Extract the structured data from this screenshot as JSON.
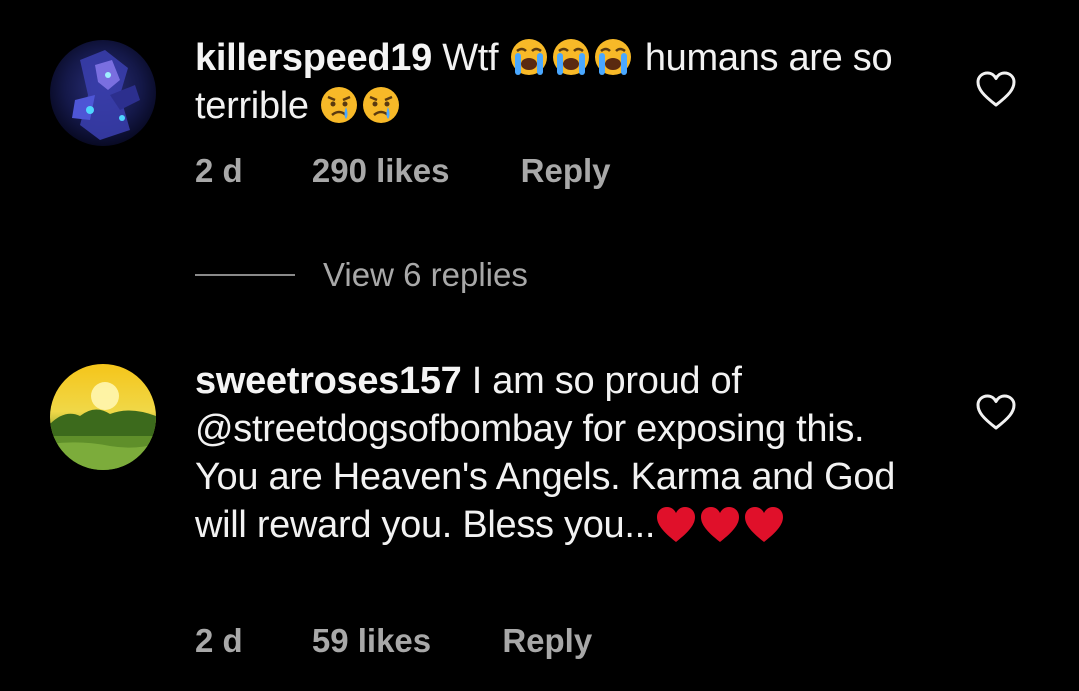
{
  "comments": [
    {
      "username": "killerspeed19",
      "text_before": "Wtf",
      "emoji_1": "loudly-crying-face",
      "text_after": "humans are so terrible",
      "emoji_2": "crying-face",
      "time": "2 d",
      "likes": "290 likes",
      "reply": "Reply",
      "view_replies": "View 6 replies"
    },
    {
      "username": "sweetroses157",
      "text": "I am so proud of @streetdogsofbombay  for exposing this.  You are Heaven's Angels.  Karma and God will reward you.  Bless you...",
      "emoji": "red-heart",
      "time": "2 d",
      "likes": "59 likes",
      "reply": "Reply"
    }
  ],
  "colors": {
    "background": "#000000",
    "text": "#f2f2f2",
    "meta": "#a8a8a8",
    "heart_red": "#e0102a"
  }
}
